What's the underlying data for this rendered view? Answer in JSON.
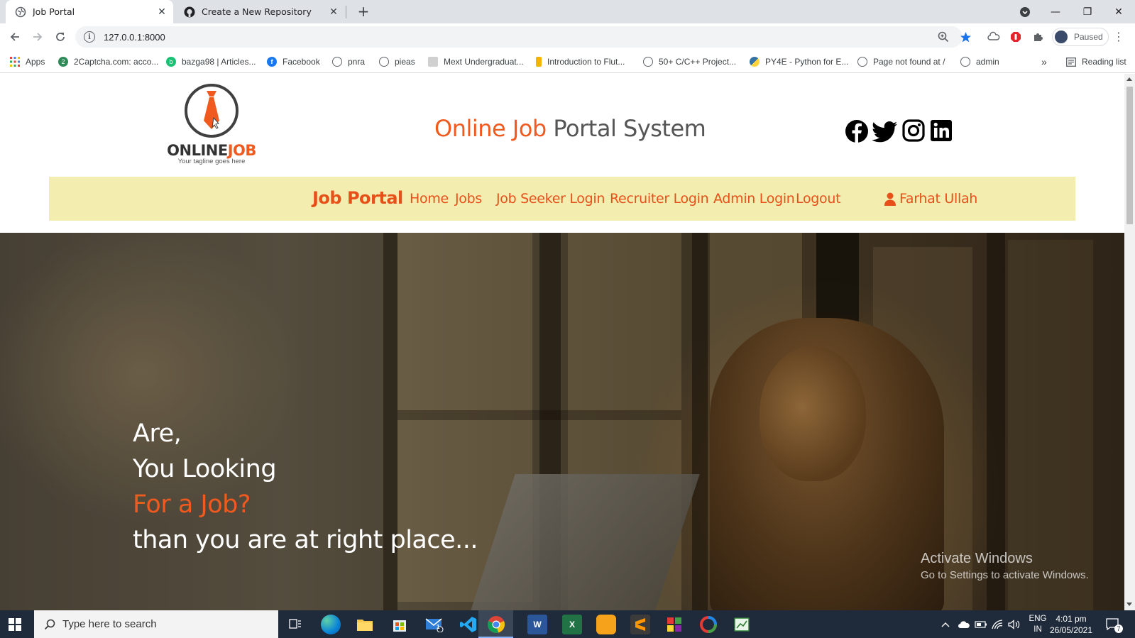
{
  "browser": {
    "tabs": [
      {
        "label": "Job Portal",
        "active": true
      },
      {
        "label": "Create a New Repository",
        "active": false
      }
    ],
    "url": "127.0.0.1:8000",
    "profile_label": "Paused",
    "bookmarks": [
      {
        "label": "Apps",
        "icon": "apps-grid-icon"
      },
      {
        "label": "2Captcha.com: acco...",
        "icon": "captcha-icon"
      },
      {
        "label": "bazga98 | Articles...",
        "icon": "bazga-icon"
      },
      {
        "label": "Facebook",
        "icon": "facebook-icon"
      },
      {
        "label": "pnra",
        "icon": "globe-icon"
      },
      {
        "label": "pieas",
        "icon": "globe-icon"
      },
      {
        "label": "Mext Undergraduat...",
        "icon": "mext-icon"
      },
      {
        "label": "Introduction to Flut...",
        "icon": "flutter-icon"
      },
      {
        "label": "50+ C/C++ Project...",
        "icon": "globe-icon"
      },
      {
        "label": "PY4E - Python for E...",
        "icon": "python-icon"
      },
      {
        "label": "Page not found at /",
        "icon": "globe-icon"
      },
      {
        "label": "admin",
        "icon": "globe-icon"
      }
    ],
    "bookmarks_overflow": "»",
    "reading_list": "Reading list"
  },
  "site": {
    "logo_word_1": "ONLINE",
    "logo_word_2": "JOB",
    "logo_tagline": "Your tagline goes here",
    "title_part_1": "Online Job",
    "title_part_2": "Portal System",
    "social_icons": [
      "facebook-icon",
      "twitter-icon",
      "instagram-icon",
      "linkedin-icon"
    ],
    "nav": {
      "brand": "Job Portal",
      "links": [
        "Home",
        "Jobs",
        "Job Seeker Login",
        "Recruiter Login",
        "Admin Login",
        "Logout"
      ],
      "user": "Farhat Ullah"
    },
    "hero": {
      "line1": "Are,",
      "line2": "You Looking",
      "line3": "For a Job?",
      "line4": "than you are at right place..."
    },
    "colors": {
      "accent": "#f05a1e",
      "navbar_bg": "#f3eeb0",
      "title_grey": "#555555"
    }
  },
  "watermark": {
    "line1": "Activate Windows",
    "line2": "Go to Settings to activate Windows."
  },
  "taskbar": {
    "search_placeholder": "Type here to search",
    "apps": [
      "task-view-icon",
      "edge-icon",
      "file-explorer-icon",
      "store-icon",
      "mail-icon",
      "vscode-icon",
      "chrome-icon",
      "word-icon",
      "excel-icon",
      "app-orange-icon",
      "sublime-icon",
      "app-multicolor-icon",
      "app-circle-icon",
      "app-green-icon"
    ],
    "mail_badge": "1",
    "lang_1": "ENG",
    "lang_2": "IN",
    "time": "4:01 pm",
    "date": "26/05/2021",
    "notifications": "7"
  }
}
